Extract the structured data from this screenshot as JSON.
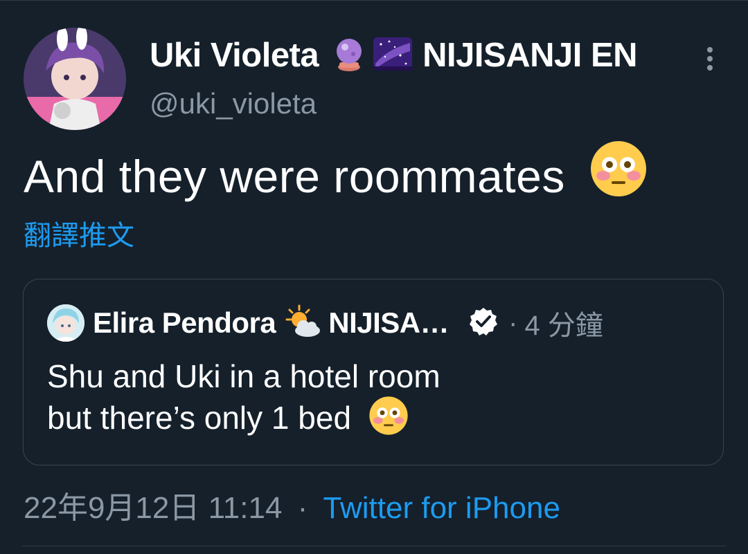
{
  "author": {
    "display_name": "Uki Violeta",
    "badge_emojis": [
      "crystal-ball-emoji",
      "milky-way-emoji"
    ],
    "brand": "NIJISANJI EN",
    "handle": "@uki_violeta"
  },
  "tweet": {
    "text": "And they were roommates",
    "text_emoji": "flushed-face-emoji",
    "translate_label": "翻譯推文"
  },
  "quote": {
    "display_name": "Elira Pendora",
    "badge_emoji": "sun-behind-cloud-emoji",
    "brand_truncated": "NIJISA…",
    "verified": true,
    "separator": "·",
    "time_ago": "4 分鐘",
    "lines": [
      "Shu and Uki in a hotel room",
      "but there’s only 1 bed"
    ],
    "text_emoji": "flushed-face-emoji"
  },
  "meta": {
    "timestamp": "22年9月12日 11:14",
    "separator": "·",
    "source": "Twitter for iPhone"
  },
  "colors": {
    "background": "#15202b",
    "link": "#1d9bf0",
    "secondary_text": "#8b98a5",
    "border": "#38444d"
  }
}
